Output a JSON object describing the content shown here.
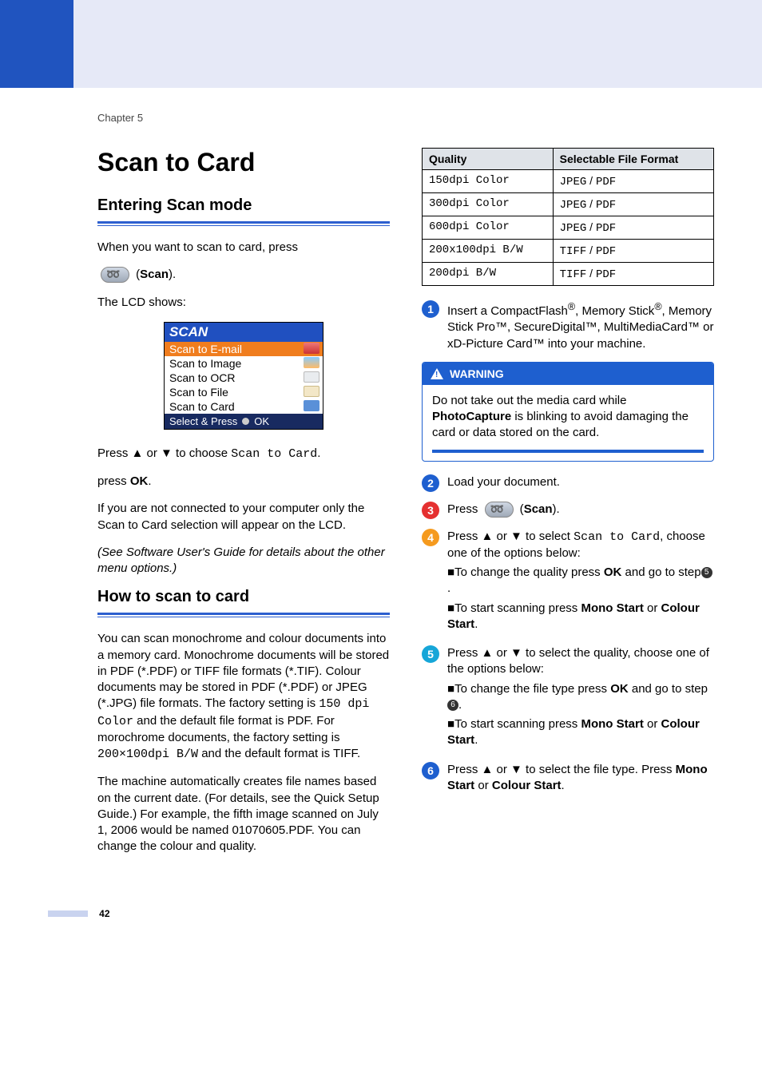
{
  "chapter": "Chapter 5",
  "title": "Scan to Card",
  "left": {
    "h2a": "Entering Scan mode",
    "intro1": "When you want to scan to card, press",
    "scan_lbl": "Scan",
    "intro2": "The LCD shows:",
    "lcd": {
      "title": "SCAN",
      "items": [
        "Scan to E-mail",
        "Scan to Image",
        "Scan to OCR",
        "Scan to File",
        "Scan to Card"
      ],
      "foot_a": "Select & Press",
      "foot_b": "OK"
    },
    "p_press": "Press ▲ or ▼ to choose ",
    "p_press_code": "Scan to Card",
    "p_press_end": ".",
    "p_ok": "press OK.",
    "p_note": "If you are not connected to your computer only the Scan to Card selection will appear on the LCD.",
    "p_see": "(See Software User's Guide for details about the other menu options.)",
    "h2b": "How to scan to card",
    "para1a": "You can scan monochrome and colour documents into a memory card. Monochrome documents will be stored in PDF (*.PDF) or TIFF file formats (*.TIF). Colour documents may be stored in PDF (*.PDF) or JPEG (*.JPG) file formats. The factory setting is ",
    "para1_code1": "150 dpi Color",
    "para1b": " and the default file format is PDF. For morochrome documents, the factory setting is ",
    "para1_code2": "200×100dpi B/W",
    "para1c": " and the default format is TIFF.",
    "para2": "The machine automatically creates file names based on the current date. (For details, see the Quick Setup Guide.) For example, the fifth image scanned on July 1, 2006 would be named 01070605.PDF. You can change the colour and quality."
  },
  "table": {
    "h1": "Quality",
    "h2": "Selectable File Format",
    "rows": [
      {
        "q": "150dpi Color",
        "f": [
          "JPEG",
          "PDF"
        ]
      },
      {
        "q": "300dpi Color",
        "f": [
          "JPEG",
          "PDF"
        ]
      },
      {
        "q": "600dpi Color",
        "f": [
          "JPEG",
          "PDF"
        ]
      },
      {
        "q": "200x100dpi B/W",
        "f": [
          "TIFF",
          "PDF"
        ]
      },
      {
        "q": "200dpi B/W",
        "f": [
          "TIFF",
          "PDF"
        ]
      }
    ]
  },
  "steps": {
    "s1a": "Insert a CompactFlash",
    "s1b": ", Memory Stick",
    "s1c": ", Memory Stick Pro™, SecureDigital™, MultiMediaCard™ or xD-Picture Card™ into your machine.",
    "warn_title": "WARNING",
    "warn_a": "Do not take out the media card while ",
    "warn_b": "PhotoCapture",
    "warn_c": " is blinking to avoid damaging the card or data stored on the card.",
    "s2": "Load your document.",
    "s3a": "Press ",
    "s3b": "Scan",
    "s4a": "Press ▲ or ▼ to select ",
    "s4code": "Scan to Card",
    "s4b": ", choose one of the options below:",
    "s4_l1a": "To change the quality press ",
    "s4_l1b": "OK",
    "s4_l1c": " and go to step",
    "s4_dot": "5",
    "s4_l2a": "To start scanning press ",
    "s4_l2b": "Mono Start",
    "s4_l2c": " or ",
    "s4_l2d": "Colour Start",
    "s5a": "Press ▲ or ▼ to select the quality, choose one of the options below:",
    "s5_l1a": "To change the file type press ",
    "s5_l1b": "OK",
    "s5_l1c": " and go to step ",
    "s5_dot": "6",
    "s5_l2a": "To start scanning press ",
    "s5_l2b": "Mono Start",
    "s5_l2c": " or ",
    "s5_l2d": "Colour Start",
    "s6a": "Press ▲ or ▼ to select the file type. Press ",
    "s6b": "Mono Start",
    "s6c": " or ",
    "s6d": "Colour Start"
  },
  "pagenum": "42"
}
